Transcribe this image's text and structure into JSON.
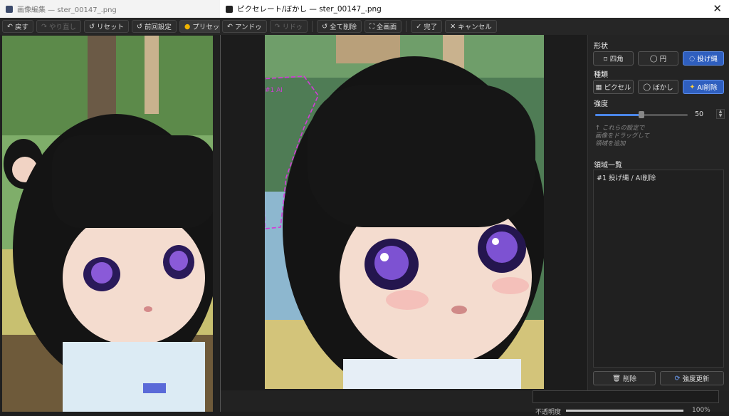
{
  "background_window": {
    "title": "画像編集 — ster_00147_.png",
    "toolbar": [
      {
        "icon": "undo-icon",
        "glyph": "↶",
        "label": "戻す",
        "enabled": true
      },
      {
        "icon": "redo-icon",
        "glyph": "↷",
        "label": "やり直し",
        "enabled": false
      },
      {
        "icon": "reset-icon",
        "glyph": "↺",
        "label": "リセット",
        "enabled": true
      },
      {
        "icon": "previous-settings-icon",
        "glyph": "↺",
        "label": "前回設定",
        "enabled": true
      },
      {
        "icon": "preset-icon",
        "glyph": "●",
        "label": "プリセット ▾",
        "enabled": true
      }
    ]
  },
  "dialog": {
    "title": "ピクセレート/ぼかし — ster_00147_.png",
    "close_glyph": "✕",
    "toolbar": {
      "undo": {
        "glyph": "↶",
        "label": "アンドゥ"
      },
      "redo": {
        "glyph": "↷",
        "label": "リドゥ"
      },
      "clear_all": {
        "glyph": "↺",
        "label": "全て削除"
      },
      "fullscreen": {
        "glyph": "⛶",
        "label": "全画面"
      },
      "done": {
        "glyph": "✓",
        "label": "完了"
      },
      "cancel": {
        "glyph": "✕",
        "label": "キャンセル"
      }
    },
    "panel": {
      "shape_title": "形状",
      "shape_options": [
        {
          "glyph": "▫",
          "label": "四角",
          "selected": false
        },
        {
          "glyph": "◯",
          "label": "円",
          "selected": false
        },
        {
          "glyph": "◌",
          "label": "投げ縄",
          "selected": true
        }
      ],
      "type_title": "種類",
      "type_options": [
        {
          "glyph": "▦",
          "label": "ピクセル",
          "selected": false
        },
        {
          "glyph": "◯",
          "label": "ぼかし",
          "selected": false
        },
        {
          "glyph": "✦",
          "label": "AI削除",
          "selected": true
        }
      ],
      "strength_title": "強度",
      "strength_value": "50",
      "strength_fraction": 0.5,
      "hint_lines": [
        "↑ これらの設定で",
        "画像をドラッグして",
        "領域を追加"
      ],
      "region_list_title": "領域一覧",
      "regions": [
        "#1 投げ縄 / AI削除"
      ],
      "delete_button": {
        "glyph": "🗑",
        "label": "削除"
      },
      "update_button": {
        "glyph": "⟳",
        "label": "強度更新"
      }
    },
    "lasso_label": "#1 AI",
    "opacity_label": "不透明度",
    "opacity_value": "100%"
  },
  "colors": {
    "accent": "#2f5fbf",
    "lasso": "#d23bd8"
  }
}
